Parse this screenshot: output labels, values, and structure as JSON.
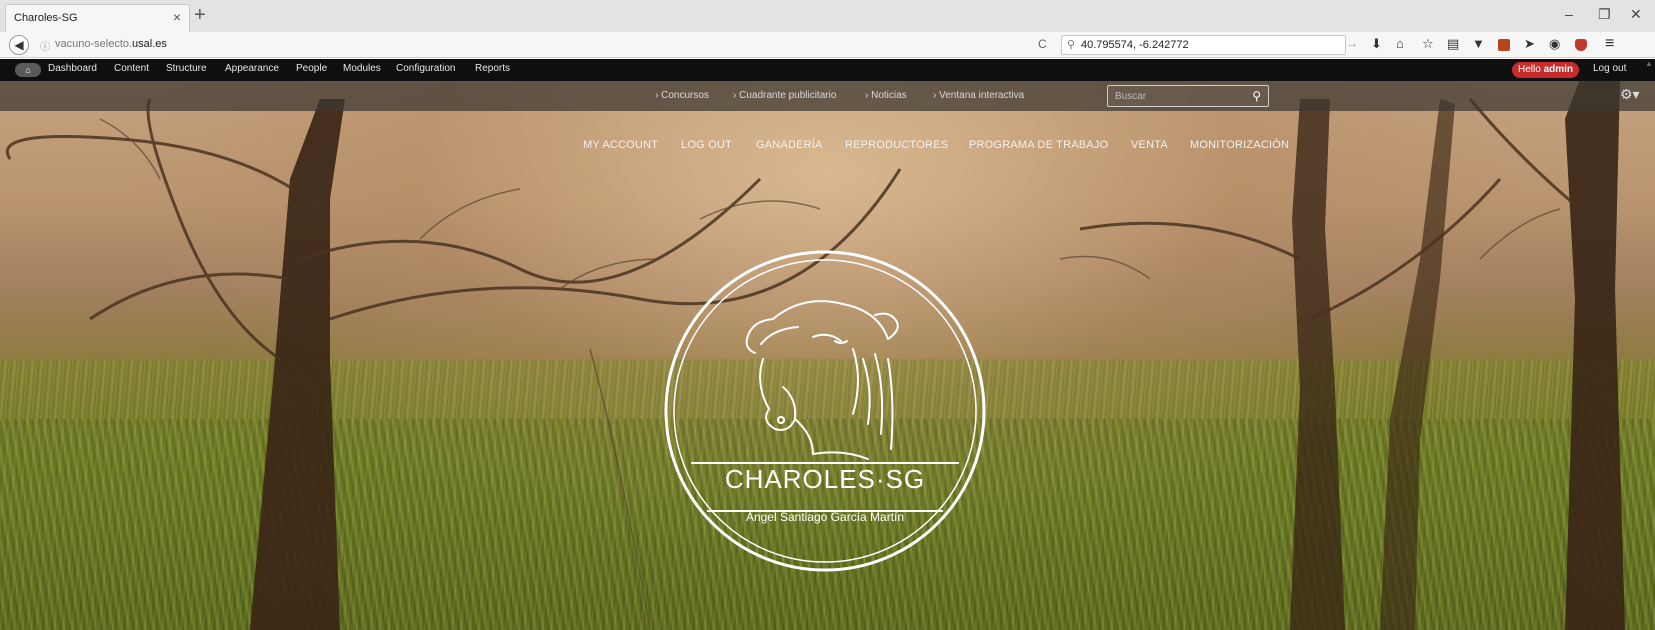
{
  "browser": {
    "tab_title": "Charoles-SG",
    "tab_close": "×",
    "new_tab": "+",
    "url_prefix": "vacuno-selecto.",
    "url_domain": "usal.es",
    "search_value": "40.795574, -6.242772",
    "window_controls": [
      "–",
      "❐",
      "✕"
    ]
  },
  "admin_toolbar": {
    "items": [
      "Dashboard",
      "Content",
      "Structure",
      "Appearance",
      "People",
      "Modules",
      "Configuration",
      "Reports"
    ],
    "hello_prefix": "Hello ",
    "hello_user": "admin",
    "logout": "Log out"
  },
  "secondary_nav": {
    "items": [
      "› Concursos",
      "› Cuadrante publicitario",
      "› Noticias",
      "› Ventana interactiva"
    ],
    "search_placeholder": "Buscar"
  },
  "main_menu": {
    "items": [
      "MY ACCOUNT",
      "LOG OUT",
      "GANADERÍA",
      "REPRODUCTORES",
      "PROGRAMA DE TRABAJO",
      "VENTA",
      "MONITORIZACIÓN"
    ]
  },
  "emblem": {
    "brand": "CHAROLES·SG",
    "author": "Angel Santiago García Martín"
  },
  "colors": {
    "admin_bar": "#0f0f0f",
    "hello_badge": "#c72b2b",
    "secondary_nav": "rgba(60,55,50,0.72)"
  },
  "icons": [
    "back-arrow-icon",
    "info-icon",
    "reload-icon",
    "search-icon",
    "forward-icon",
    "download-icon",
    "home-icon",
    "bookmark-star-icon",
    "clipboard-icon",
    "pocket-icon",
    "extension-icon",
    "send-icon",
    "chat-icon",
    "shield-icon",
    "menu-icon",
    "gear-icon"
  ]
}
